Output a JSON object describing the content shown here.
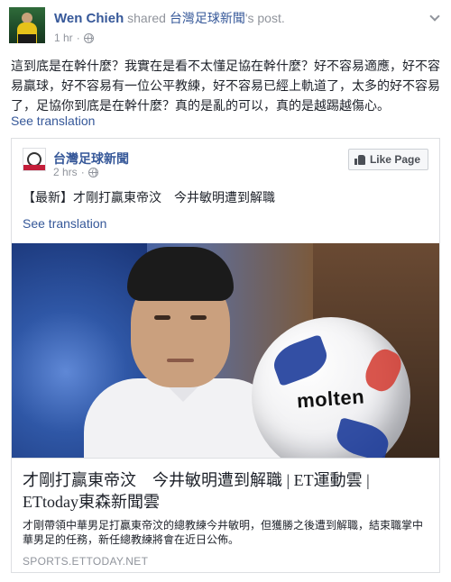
{
  "post": {
    "author": "Wen Chieh",
    "shared_text": " shared ",
    "shared_page": "台灣足球新聞",
    "post_suffix": "'s post.",
    "time": "1 hr",
    "time_separator": "·",
    "message": "這到底是在幹什麼？我實在是看不太懂足協在幹什麼？好不容易適應，好不容易贏球，好不容易有一位公平教練，好不容易已經上軌道了，太多的好不容易了，足協你到底是在幹什麼？真的是亂的可以，真的是越踢越傷心。",
    "see_translation": "See translation"
  },
  "shared_post": {
    "page_name": "台灣足球新聞",
    "time": "2 hrs",
    "time_separator": "·",
    "like_button": "Like Page",
    "message": "【最新】才剛打贏東帝汶　今井敏明遭到解職",
    "see_translation": "See translation",
    "article": {
      "title": "才剛打贏東帝汶　今井敏明遭到解職 | ET運動雲 | ETtoday東森新聞雲",
      "description": "才剛帶領中華男足打贏東帝汶的總教練今井敏明，但獲勝之後遭到解職，結束職掌中華男足的任務，新任總教練將會在近日公佈。",
      "source": "SPORTS.ETTODAY.NET",
      "image_ball_brand": "molten"
    }
  },
  "icons": {
    "globe": "globe-icon",
    "chevron": "chevron-down-icon",
    "like": "thumbs-up-icon"
  },
  "colors": {
    "link": "#365899",
    "meta": "#90949c",
    "text": "#1d2129",
    "border": "#dddfe2"
  }
}
